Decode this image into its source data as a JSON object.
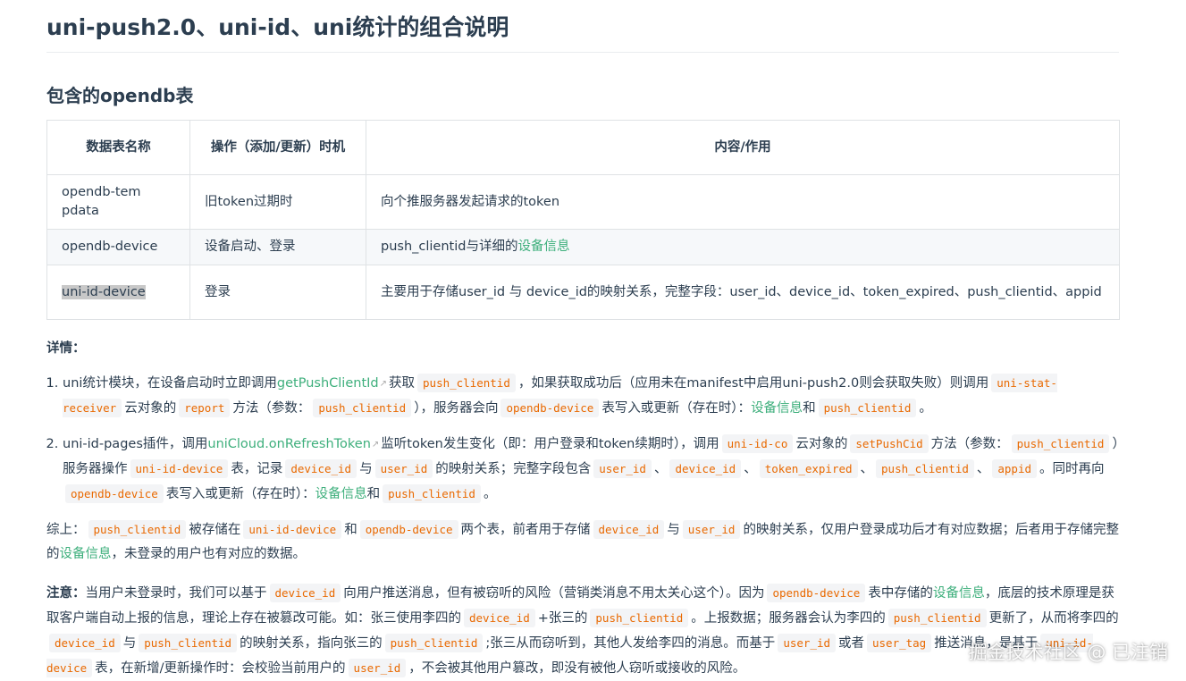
{
  "title": "uni-push2.0、uni-id、uni统计的组合说明",
  "section_title": "包含的opendb表",
  "table": {
    "headers": [
      "数据表名称",
      "操作（添加/更新）时机",
      "内容/作用"
    ],
    "rows": [
      {
        "name": "opendb-tempdata",
        "timing": "旧token过期时",
        "content": "向个推服务器发起请求的token"
      },
      {
        "name": "opendb-device",
        "timing": "设备启动、登录",
        "content_text": "push_clientid与详细的",
        "content_link": "设备信息"
      },
      {
        "name": "uni-id-device",
        "timing": "登录",
        "content": "主要用于存储user_id 与 device_id的映射关系，完整字段：user_id、device_id、token_expired、push_clientid、appid"
      }
    ]
  },
  "details_label": "详情：",
  "list": [
    {
      "t1": "uni统计模块，在设备启动时立即调用",
      "link1": "getPushClientId",
      "t2": "获取",
      "c1": "push_clientid",
      "t3": "，如果获取成功后（应用未在manifest中启用uni-push2.0则会获取失败）则调用",
      "c2": "uni-stat-receiver",
      "t4": "云对象的",
      "c3": "report",
      "t5": "方法（参数：",
      "c4": "push_clientid",
      "t6": "），服务器会向",
      "c5": "opendb-device",
      "t7": "表写入或更新（存在时）：",
      "link2": "设备信息",
      "t8": "和",
      "c6": "push_clientid",
      "t9": "。"
    },
    {
      "t1": "uni-id-pages插件，调用",
      "link1": "uniCloud.onRefreshToken",
      "t2": "监听token发生变化（即：用户登录和token续期时），调用",
      "c1": "uni-id-co",
      "t3": "云对象的",
      "c2": "setPushCid",
      "t4": "方法（参数：",
      "c3": "push_clientid",
      "t5": "）服务器操作",
      "c4": "uni-id-device",
      "t6": "表，记录",
      "c5": "device_id",
      "t7": "与",
      "c6": "user_id",
      "t8": "的映射关系；完整字段包含",
      "c7": "user_id",
      "t9": "、",
      "c8": "device_id",
      "t10": "、",
      "c9": "token_expired",
      "t11": "、",
      "c10": "push_clientid",
      "t12": "、",
      "c11": "appid",
      "t13": "。同时再向",
      "c12": "opendb-device",
      "t14": "表写入或更新（存在时）：",
      "link2": "设备信息",
      "t15": "和",
      "c13": "push_clientid",
      "t16": "。"
    }
  ],
  "summary": {
    "t1": "综上：",
    "c1": "push_clientid",
    "t2": "被存储在",
    "c2": "uni-id-device",
    "t3": "和",
    "c3": "opendb-device",
    "t4": "两个表，前者用于存储",
    "c4": "device_id",
    "t5": "与",
    "c5": "user_id",
    "t6": "的映射关系，仅用户登录成功后才有对应数据；后者用于存储完整的",
    "link1": "设备信息",
    "t7": "，未登录的用户也有对应的数据。"
  },
  "note": {
    "label": "注意：",
    "t1": "当用户未登录时，我们可以基于",
    "c1": "device_id",
    "t2": "向用户推送消息，但有被窃听的风险（营销类消息不用太关心这个）。因为",
    "c2": "opendb-device",
    "t3": "表中存储的",
    "link1": "设备信息",
    "t4": "，底层的技术原理是获取客户端自动上报的信息，理论上存在被篡改可能。如：张三使用李四的",
    "c3": "device_id",
    "t5": "+张三的",
    "c4": "push_clientid",
    "t6": "。上报数据；服务器会认为李四的",
    "c5": "push_clientid",
    "t7": "更新了，从而将李四的",
    "c6": "device_id",
    "t8": "与",
    "c7": "push_clientid",
    "t9": "的映射关系，指向张三的",
    "c8": "push_clientid",
    "t10": ";张三从而窃听到，其他人发给李四的消息。而基于",
    "c9": "user_id",
    "t11": "或者",
    "c10": "user_tag",
    "t12": "推送消息，是基于",
    "c11": "uni-id-device",
    "t13": "表，在新增/更新操作时：会校验当前用户的",
    "c12": "user_id",
    "t14": "，不会被其他用户篡改，即没有被他人窃听或接收的风险。"
  },
  "watermark": "掘金技术社区 @ 已注销",
  "colors": {
    "link": "#3eaf7c",
    "code": "#e96900",
    "code_bg": "#f3f4f6",
    "text": "#2c3e50"
  },
  "icons": {
    "external": "external-link-icon"
  }
}
